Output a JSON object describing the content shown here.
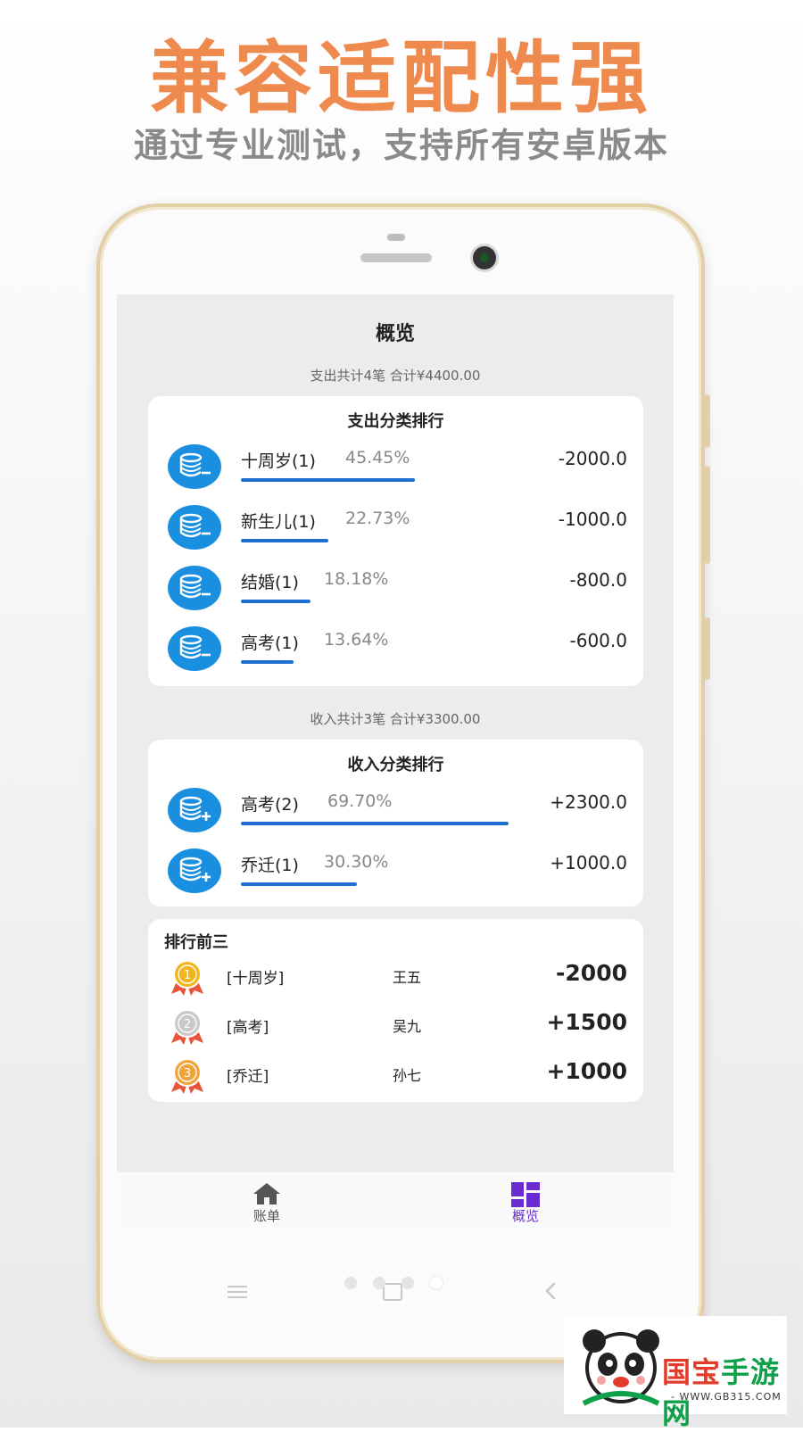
{
  "promo": {
    "headline": "兼容适配性强",
    "subline": "通过专业测试，支持所有安卓版本"
  },
  "app": {
    "title": "概览",
    "expense_summary": "支出共计4笔   合计¥4400.00",
    "expense_card": {
      "title": "支出分类排行",
      "items": [
        {
          "name": "十周岁(1)",
          "percent": "45.45%",
          "amount": "-2000.0",
          "ratio": 0.4545
        },
        {
          "name": "新生儿(1)",
          "percent": "22.73%",
          "amount": "-1000.0",
          "ratio": 0.2273
        },
        {
          "name": "结婚(1)",
          "percent": "18.18%",
          "amount": "-800.0",
          "ratio": 0.1818
        },
        {
          "name": "高考(1)",
          "percent": "13.64%",
          "amount": "-600.0",
          "ratio": 0.1364
        }
      ]
    },
    "income_summary": "收入共计3笔   合计¥3300.00",
    "income_card": {
      "title": "收入分类排行",
      "items": [
        {
          "name": "高考(2)",
          "percent": "69.70%",
          "amount": "+2300.0",
          "ratio": 0.697
        },
        {
          "name": "乔迁(1)",
          "percent": "30.30%",
          "amount": "+1000.0",
          "ratio": 0.303
        }
      ]
    },
    "top3": {
      "title": "排行前三",
      "items": [
        {
          "rank": "1",
          "category": "[十周岁]",
          "person": "王五",
          "amount": "-2000"
        },
        {
          "rank": "2",
          "category": "[高考]",
          "person": "吴九",
          "amount": "+1500"
        },
        {
          "rank": "3",
          "category": "[乔迁]",
          "person": "孙七",
          "amount": "+1000"
        }
      ]
    },
    "tabs": [
      {
        "label": "账单",
        "active": false
      },
      {
        "label": "概览",
        "active": true
      }
    ],
    "colors": {
      "accent": "#1a8fe0",
      "bar": "#1f6fd0",
      "active_tab": "#6a2cd0",
      "inactive_tab": "#555555",
      "headline": "#ef8a4f"
    }
  },
  "watermark": {
    "text": "国宝手游网",
    "url": "- WWW.GB315.COM -"
  }
}
